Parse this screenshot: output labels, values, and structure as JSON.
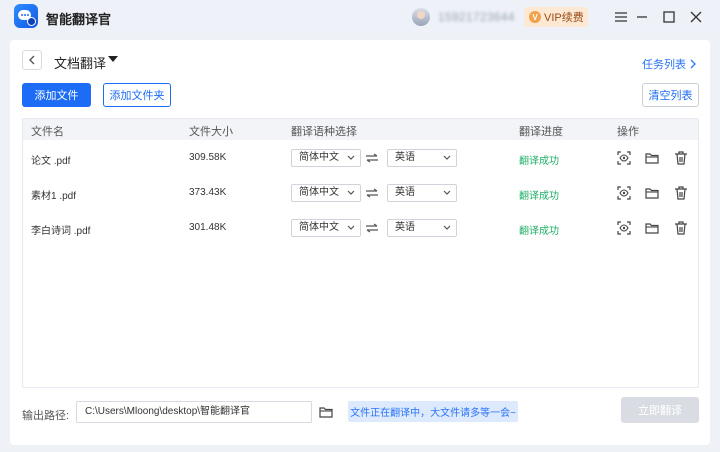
{
  "app": {
    "title": "智能翻译官",
    "phone": "15921723644",
    "vip_label": "VIP续费"
  },
  "page": {
    "title": "文档翻译",
    "task_list_link": "任务列表"
  },
  "toolbar": {
    "add_file": "添加文件",
    "add_folder": "添加文件夹",
    "clear_list": "清空列表"
  },
  "table": {
    "headers": [
      "文件名",
      "文件大小",
      "翻译语种选择",
      "翻译进度",
      "操作"
    ],
    "rows": [
      {
        "name": "论文 .pdf",
        "size": "309.58K",
        "source_lang": "简体中文",
        "target_lang": "英语",
        "status": "翻译成功"
      },
      {
        "name": "素材1 .pdf",
        "size": "373.43K",
        "source_lang": "简体中文",
        "target_lang": "英语",
        "status": "翻译成功"
      },
      {
        "name": "李白诗词 .pdf",
        "size": "301.48K",
        "source_lang": "简体中文",
        "target_lang": "英语",
        "status": "翻译成功"
      }
    ]
  },
  "footer": {
    "output_label": "输出路径:",
    "output_path": "C:\\Users\\Mloong\\desktop\\智能翻译官",
    "notice": "文件正在翻译中，大文件请多等一会~",
    "translate_button": "立即翻译"
  },
  "colors": {
    "primary": "#1d6cf5",
    "success": "#1fae66",
    "disabled": "#d9dde3",
    "notice_bg": "#dde9fc",
    "vip_bg": "#fde8d4"
  },
  "icons": [
    "app-logo-icon",
    "vip-crown-icon",
    "menu-icon",
    "minimize-icon",
    "maximize-icon",
    "close-icon",
    "back-arrow-icon",
    "caret-down-icon",
    "chevron-right-icon",
    "swap-icon",
    "preview-icon",
    "folder-icon",
    "trash-icon"
  ]
}
